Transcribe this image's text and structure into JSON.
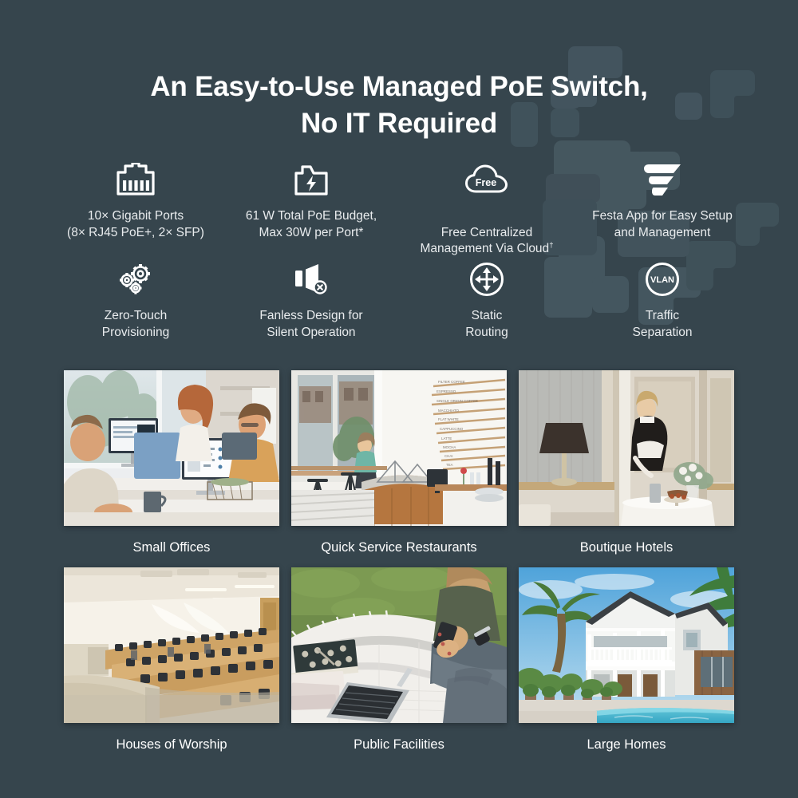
{
  "theme": {
    "background": "#36454d",
    "pattern_color": "#455761",
    "text_primary": "#ffffff",
    "text_secondary": "#e9ecee"
  },
  "headline": {
    "line1": "An Easy-to-Use Managed PoE Switch,",
    "line2": "No IT Required"
  },
  "features_row1": [
    {
      "icon": "rj45-port-icon",
      "label": "10× Gigabit Ports\n(8× RJ45 PoE+, 2× SFP)"
    },
    {
      "icon": "poe-power-budget-icon",
      "label": "61 W Total PoE Budget,\nMax 30W per Port*"
    },
    {
      "icon": "free-cloud-icon",
      "icon_text": "Free",
      "label": "Free Centralized\nManagement Via Cloud†"
    },
    {
      "icon": "festa-logo-icon",
      "label": "Festa App for Easy Setup\nand Management"
    }
  ],
  "features_row2": [
    {
      "icon": "gears-icon",
      "label": "Zero-Touch\nProvisioning"
    },
    {
      "icon": "speaker-mute-icon",
      "label": "Fanless Design for\nSilent Operation"
    },
    {
      "icon": "static-routing-icon",
      "label": "Static\nRouting"
    },
    {
      "icon": "vlan-icon",
      "icon_text": "VLAN",
      "label": "Traffic\nSeparation"
    }
  ],
  "photos_row1": [
    {
      "caption": "Small Offices",
      "scene": "office-workers-at-monitors"
    },
    {
      "caption": "Quick Service Restaurants",
      "scene": "coffee-shop-counter-menu-board"
    },
    {
      "caption": "Boutique Hotels",
      "scene": "hotel-interior-staff-serving"
    }
  ],
  "photos_row2": [
    {
      "caption": "Houses of Worship",
      "scene": "lecture-hall-tiered-seating"
    },
    {
      "caption": "Public Facilities",
      "scene": "person-outdoors-laptop-phone-blanket"
    },
    {
      "caption": "Large Homes",
      "scene": "white-two-story-house-with-pool"
    }
  ]
}
